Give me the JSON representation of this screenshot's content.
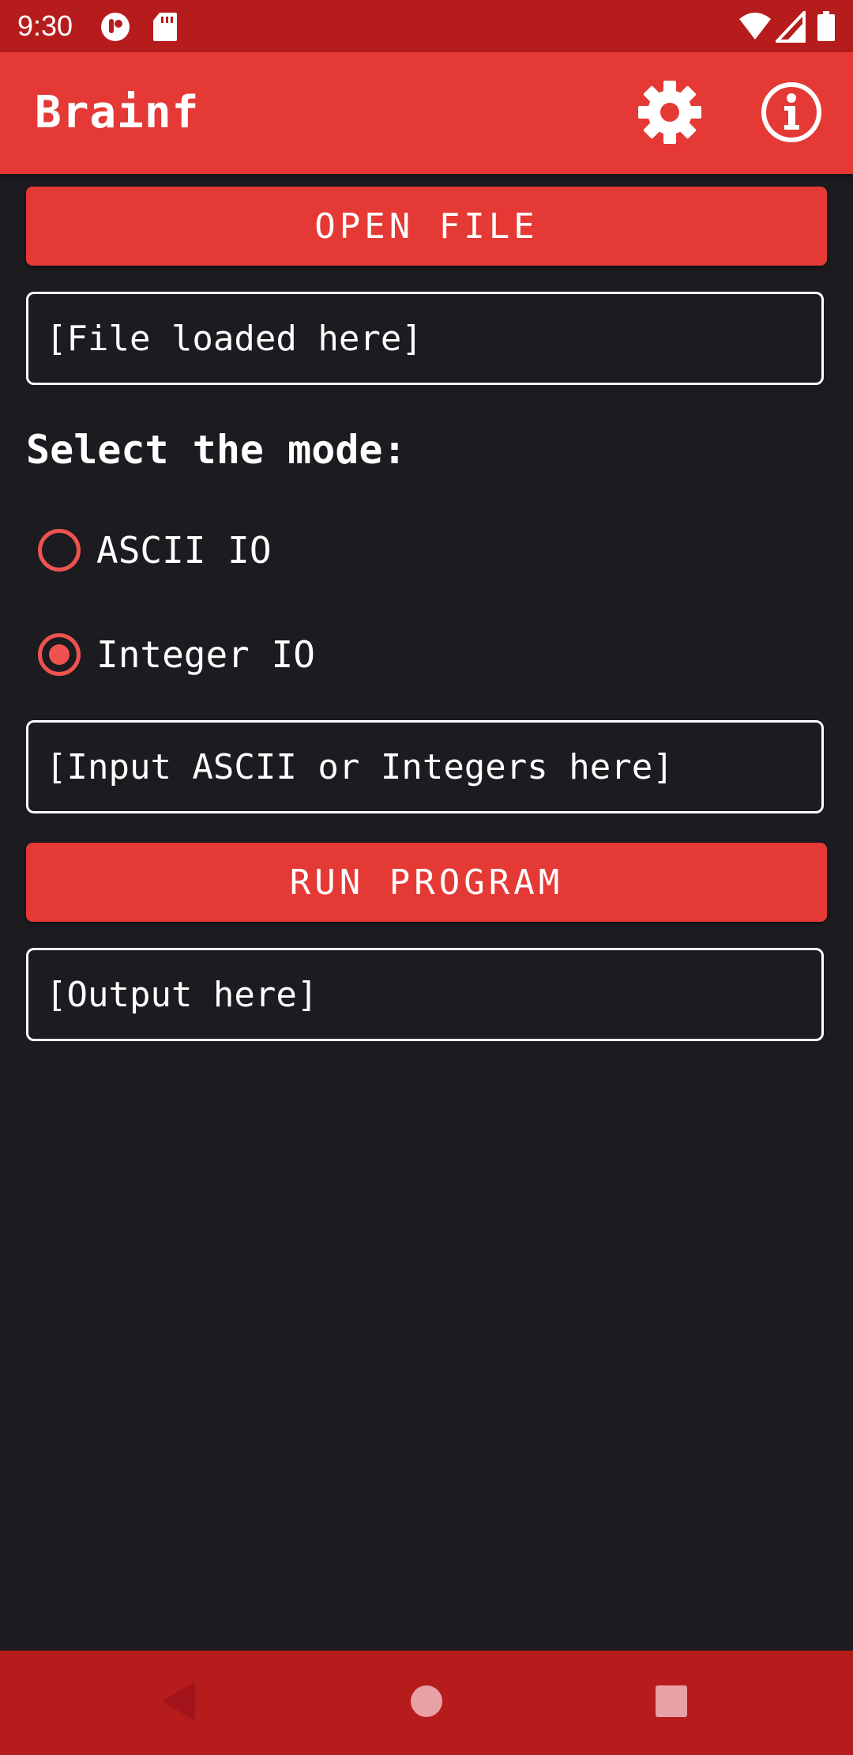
{
  "status_bar": {
    "time": "9:30",
    "icons": [
      "notification-icon",
      "sd-card-icon",
      "wifi-icon",
      "cell-signal-icon",
      "battery-icon"
    ]
  },
  "app_bar": {
    "title": "Brainf",
    "actions": [
      "settings-icon",
      "info-icon"
    ]
  },
  "main": {
    "open_file_label": "OPEN FILE",
    "file_field_text": "[File loaded here]",
    "mode_label": "Select the mode:",
    "modes": [
      {
        "label": "ASCII IO",
        "selected": false
      },
      {
        "label": "Integer IO",
        "selected": true
      }
    ],
    "input_field_text": "[Input ASCII or Integers here]",
    "run_label": "RUN PROGRAM",
    "output_field_text": "[Output here]"
  },
  "nav_bar": {
    "buttons": [
      "back-icon",
      "home-icon",
      "recents-icon"
    ]
  },
  "colors": {
    "primary": "#e53935",
    "primary_dark": "#b71c1c",
    "accent": "#ef5350",
    "background": "#1b1b20",
    "text": "#ffffff"
  }
}
